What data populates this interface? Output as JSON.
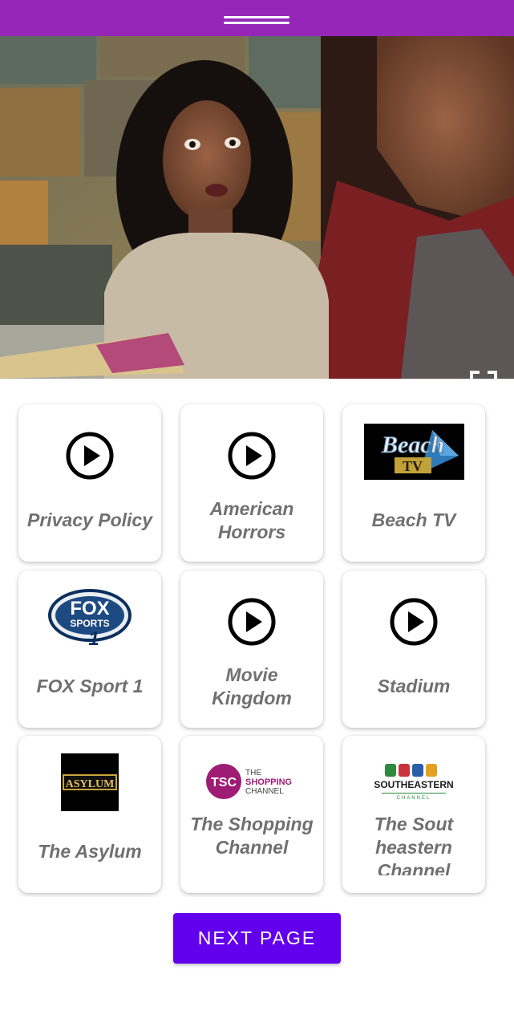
{
  "header": {
    "menu_icon": "drag-handle-icon",
    "color": "#9626b8"
  },
  "player": {
    "fullscreen_icon": "fullscreen-icon"
  },
  "channels": [
    {
      "label": "Privacy Policy",
      "icon": "play-circle-icon"
    },
    {
      "label": "American Horrors",
      "icon": "play-circle-icon"
    },
    {
      "label": "Beach TV",
      "logo_line1": "Beach",
      "logo_line2": "TV"
    },
    {
      "label": "FOX Sport 1",
      "logo_line1": "FOX",
      "logo_line2": "SPORTS",
      "logo_num": "1"
    },
    {
      "label": "Movie Kingdom",
      "icon": "play-circle-icon"
    },
    {
      "label": "Stadium",
      "icon": "play-circle-icon"
    },
    {
      "label": "The Asylum",
      "logo_text": "ASYLUM"
    },
    {
      "label": "The Shopping Channel",
      "logo_badge": "TSC",
      "logo_line1": "THE",
      "logo_line2": "SHOPPING",
      "logo_line3": "CHANNEL"
    },
    {
      "label": "The Sout heastern Channel",
      "logo_line1": "SOUTHEASTERN",
      "logo_line2": "CHANNEL"
    }
  ],
  "footer": {
    "next_label": "NEXT PAGE",
    "accent": "#6200ee"
  }
}
